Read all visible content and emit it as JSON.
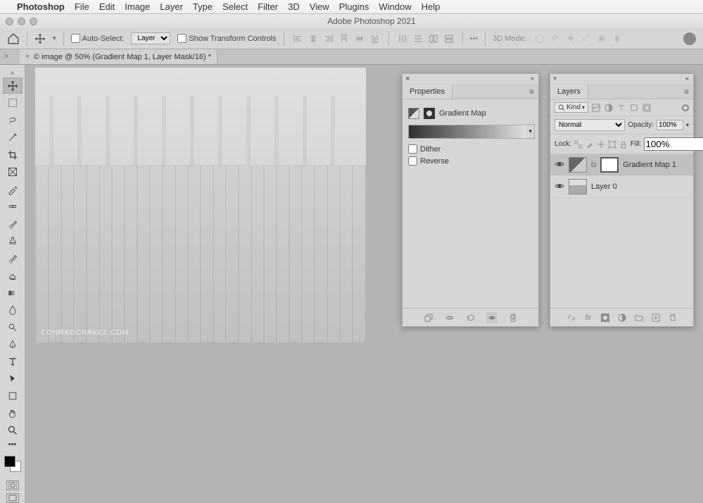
{
  "menubar": {
    "app": "Photoshop",
    "items": [
      "File",
      "Edit",
      "Image",
      "Layer",
      "Type",
      "Select",
      "Filter",
      "3D",
      "View",
      "Plugins",
      "Window",
      "Help"
    ]
  },
  "window": {
    "title": "Adobe Photoshop 2021"
  },
  "options": {
    "auto_select_label": "Auto-Select:",
    "auto_select_checked": false,
    "auto_select_target": "Layer",
    "show_transform_label": "Show Transform Controls",
    "show_transform_checked": false,
    "mode3d_label": "3D Mode:"
  },
  "document": {
    "tab_title": "© image @ 50% (Gradient Map 1, Layer Mask/16) *",
    "watermark": "CONRADCHAVEZ.COM"
  },
  "properties": {
    "panel_title": "Properties",
    "adjustment_name": "Gradient Map",
    "dither_label": "Dither",
    "dither_checked": false,
    "reverse_label": "Reverse",
    "reverse_checked": false
  },
  "layers_panel": {
    "panel_title": "Layers",
    "filter_kind_label": "Kind",
    "blend_mode": "Normal",
    "opacity_label": "Opacity:",
    "opacity_value": "100%",
    "lock_label": "Lock:",
    "fill_label": "Fill:",
    "fill_value": "100%",
    "layers": [
      {
        "name": "Gradient Map 1",
        "visible": true,
        "selected": true,
        "type": "adjustment",
        "has_mask": true
      },
      {
        "name": "Layer 0",
        "visible": true,
        "selected": false,
        "type": "pixel",
        "has_mask": false
      }
    ]
  }
}
